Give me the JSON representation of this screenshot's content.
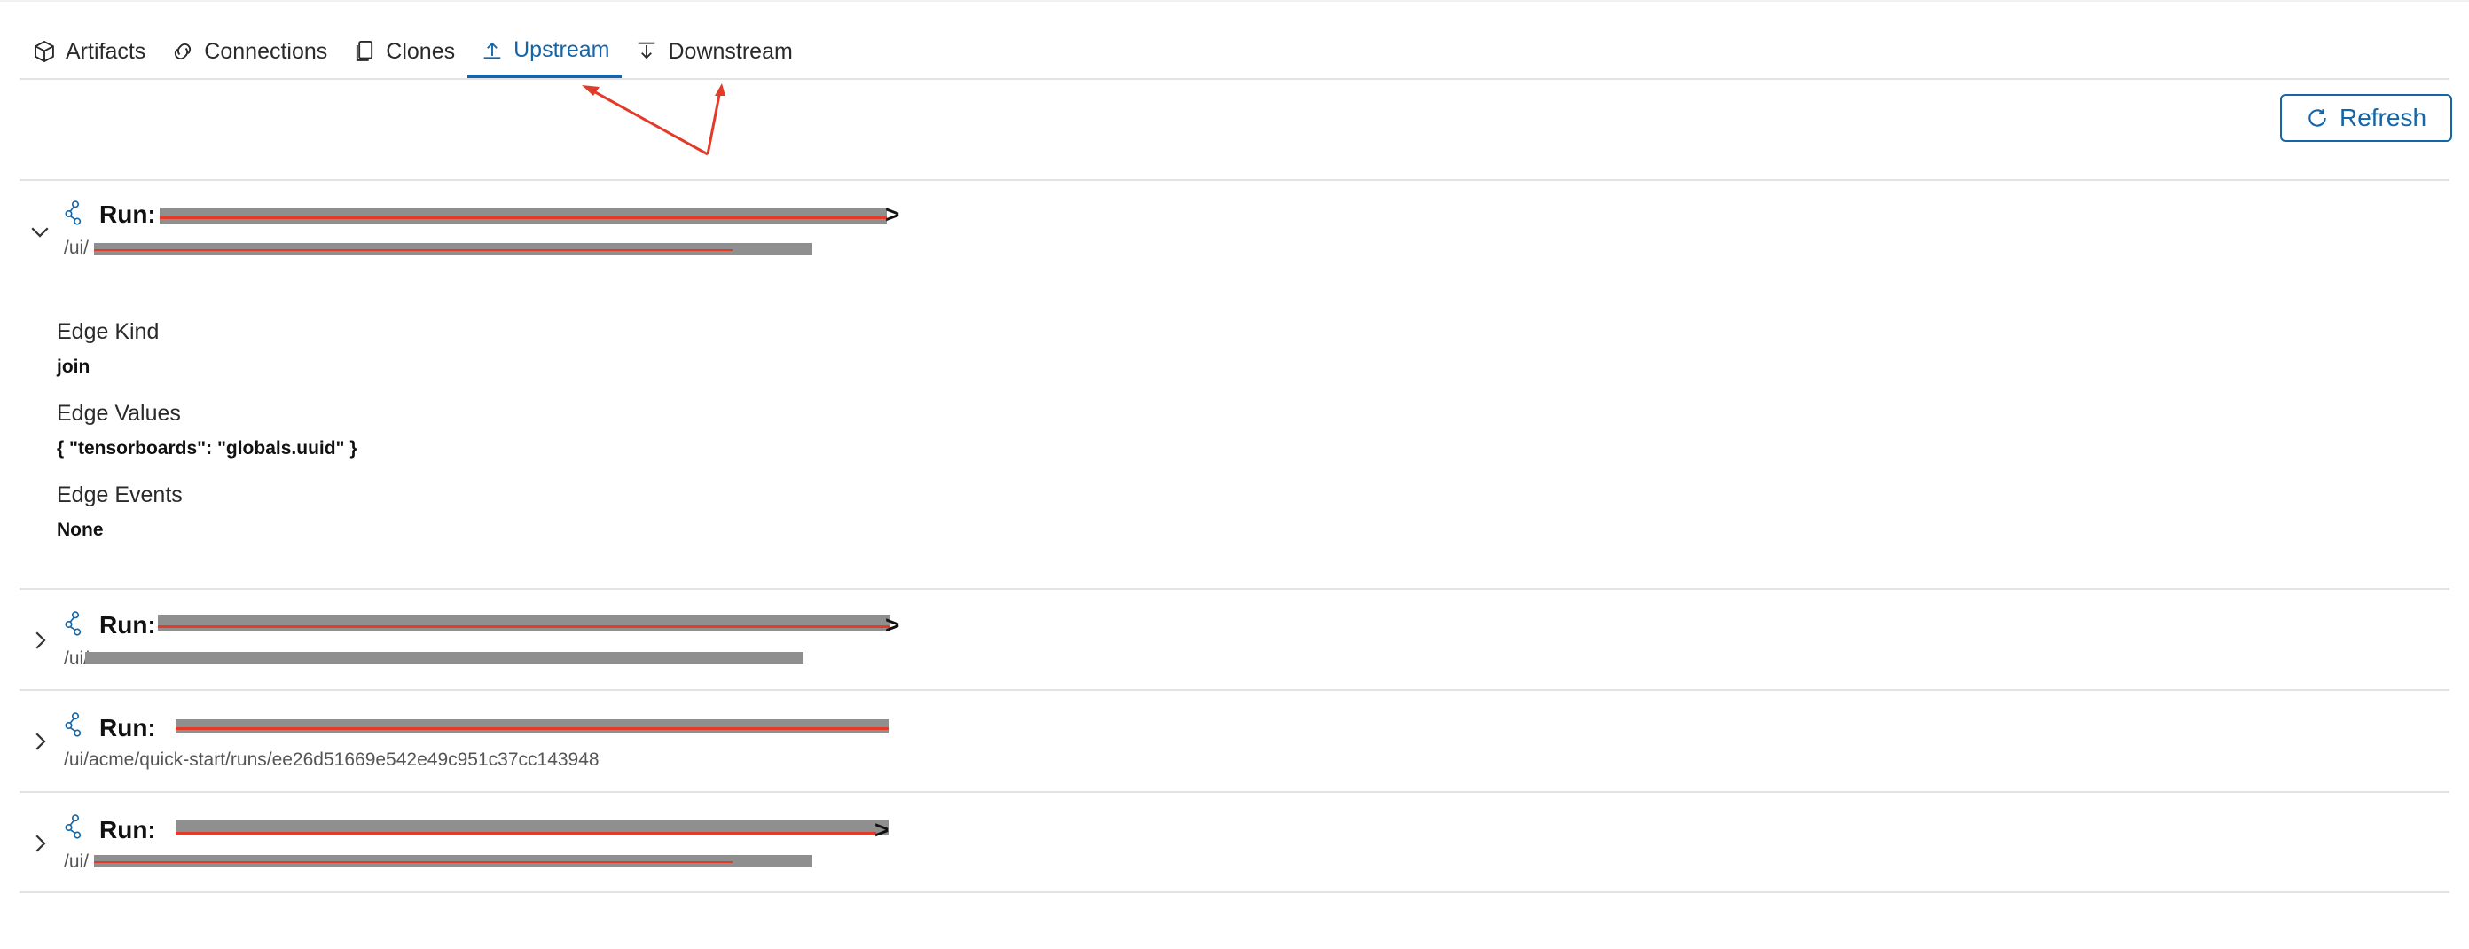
{
  "tabs": [
    {
      "label": "Artifacts",
      "icon": "cube-icon",
      "active": false
    },
    {
      "label": "Connections",
      "icon": "connections-icon",
      "active": false
    },
    {
      "label": "Clones",
      "icon": "clones-icon",
      "active": false
    },
    {
      "label": "Upstream",
      "icon": "upstream-icon",
      "active": true
    },
    {
      "label": "Downstream",
      "icon": "downstream-icon",
      "active": false
    }
  ],
  "toolbar": {
    "refresh_label": "Refresh",
    "refresh_icon": "refresh-icon"
  },
  "rows": [
    {
      "run_label": "Run:",
      "run_suffix": ">",
      "path_prefix": "/ui/",
      "path": "",
      "expanded": true,
      "details": [
        {
          "label": "Edge Kind",
          "value": "join"
        },
        {
          "label": "Edge Values",
          "value": "{ \"tensorboards\": \"globals.uuid\" }"
        },
        {
          "label": "Edge Events",
          "value": "None"
        }
      ]
    },
    {
      "run_label": "Run:",
      "run_suffix": ">",
      "path_prefix": "/ui/",
      "path": "",
      "expanded": false
    },
    {
      "run_label": "Run:",
      "run_suffix": "",
      "path_prefix": "",
      "path": "/ui/acme/quick-start/runs/ee26d51669e542e49c951c37cc143948",
      "expanded": false
    },
    {
      "run_label": "Run:",
      "run_suffix": ">",
      "path_prefix": "/ui/",
      "path": "",
      "expanded": false
    }
  ],
  "colors": {
    "accent": "#1565a8",
    "annotation": "#e23b2a",
    "redaction": "#8f8f8f"
  }
}
